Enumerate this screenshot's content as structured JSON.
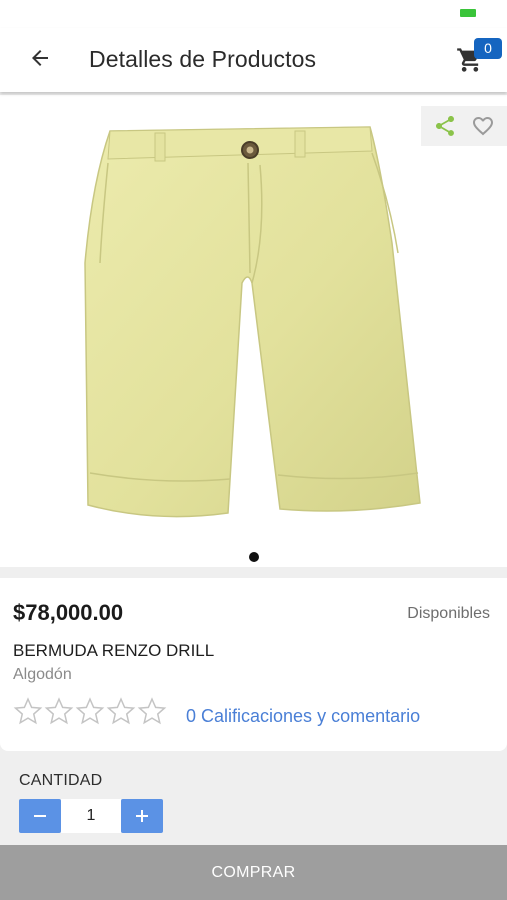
{
  "status_bar": {
    "battery_color": "#3ac43a"
  },
  "app_bar": {
    "title": "Detalles de Productos",
    "back_icon": "arrow-left-icon",
    "cart_icon": "cart-icon",
    "cart_count": "0"
  },
  "image_area": {
    "share_icon": "share-icon",
    "favorite_icon": "heart-outline-icon",
    "product_image": "yellow bermuda shorts",
    "carousel_index": 1,
    "carousel_total": 1
  },
  "product": {
    "price": "$78,000.00",
    "availability": "Disponibles",
    "name": "BERMUDA RENZO DRILL",
    "category": "Algodón",
    "rating": 0,
    "rating_max": 5,
    "ratings_link": "0 Calificaciones y comentario"
  },
  "quantity": {
    "label": "CANTIDAD",
    "value": "1",
    "minus_icon": "minus-icon",
    "plus_icon": "plus-icon"
  },
  "buy_button": {
    "label": "COMPRAR"
  },
  "colors": {
    "accent": "#5b92e5",
    "badge": "#1565c0",
    "link": "#4a7fd6",
    "share": "#8bc34a",
    "buy_bg": "#9e9e9e"
  }
}
